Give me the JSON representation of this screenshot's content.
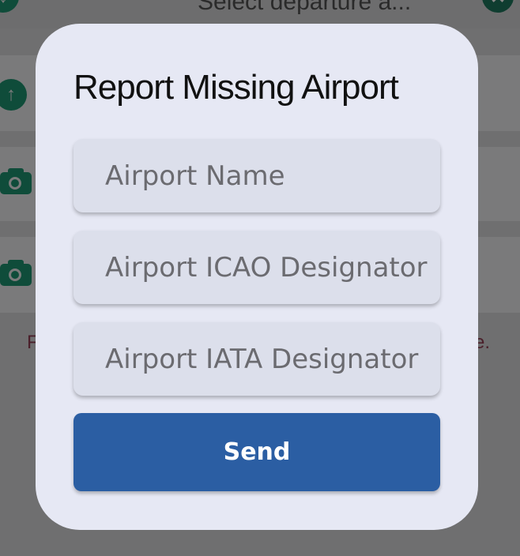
{
  "background": {
    "top_text": "Select departure a...",
    "fragment_left": "F",
    "fragment_right": "e."
  },
  "dialog": {
    "title": "Report Missing Airport",
    "fields": [
      {
        "placeholder": "Airport Name",
        "value": ""
      },
      {
        "placeholder": "Airport ICAO Designator",
        "value": ""
      },
      {
        "placeholder": "Airport IATA Designator",
        "value": ""
      }
    ],
    "send_label": "Send"
  },
  "colors": {
    "dialog_bg": "#e6e8f4",
    "field_bg": "#dcdfeb",
    "button": "#2b5ea3",
    "icon_green": "#0f4c3a"
  },
  "icons": [
    "download-icon",
    "close-icon",
    "upload-icon",
    "camera-icon"
  ]
}
